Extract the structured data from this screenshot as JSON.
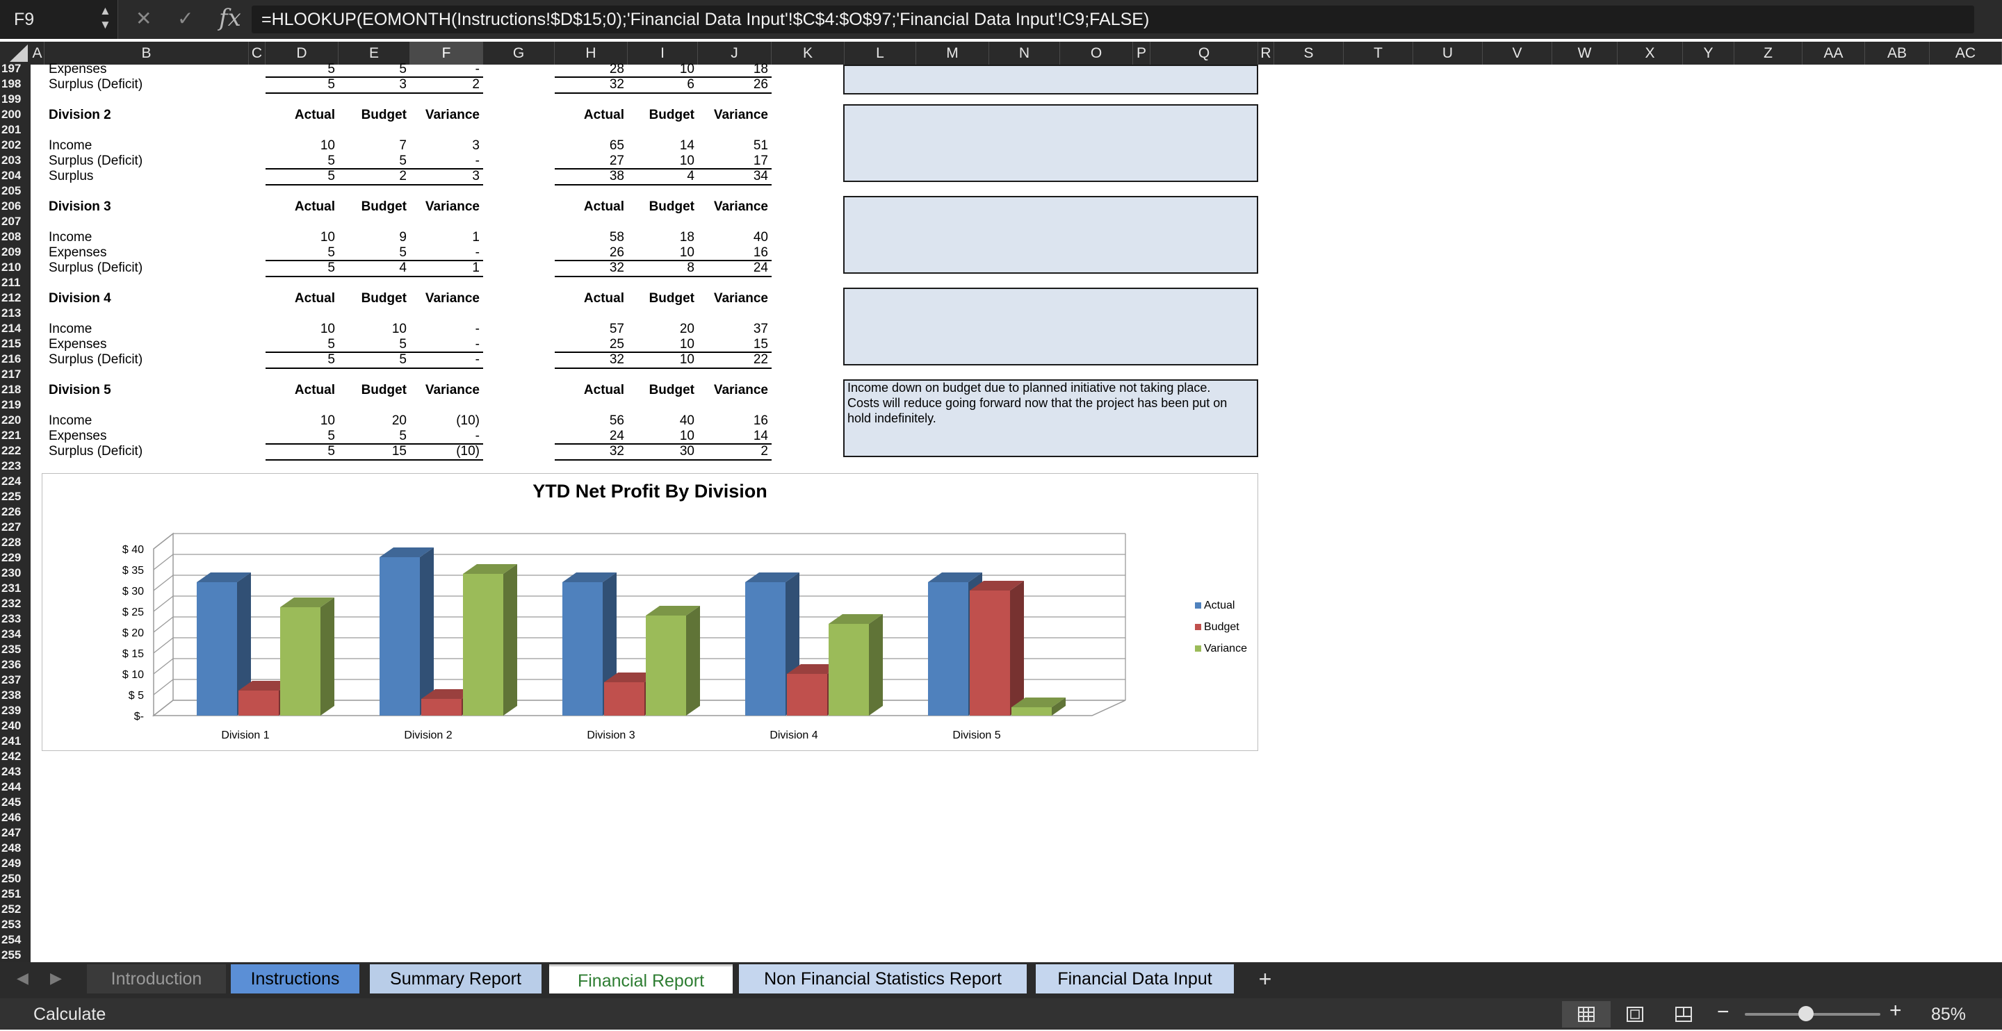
{
  "formula_bar": {
    "name_box": "F9",
    "formula": "=HLOOKUP(EOMONTH(Instructions!$D$15;0);'Financial Data Input'!$C$4:$O$97;'Financial Data Input'!C9;FALSE)"
  },
  "columns": [
    "A",
    "B",
    "C",
    "D",
    "E",
    "F",
    "G",
    "H",
    "I",
    "J",
    "K",
    "L",
    "M",
    "N",
    "O",
    "P",
    "Q",
    "R",
    "S",
    "T",
    "U",
    "V",
    "W",
    "X",
    "Y",
    "Z",
    "AA",
    "AB",
    "AC"
  ],
  "selected_column": "F",
  "rows_start": 197,
  "rows_end": 255,
  "sheet": {
    "top_rows": [
      {
        "label": "Expenses",
        "d": "5",
        "e": "5",
        "f": "-",
        "h": "28",
        "i": "10",
        "j": "18"
      },
      {
        "label": "Surplus (Deficit)",
        "d": "5",
        "e": "3",
        "f": "2",
        "h": "32",
        "i": "6",
        "j": "26"
      }
    ],
    "header_labels": {
      "actual": "Actual",
      "budget": "Budget",
      "variance": "Variance"
    },
    "divisions": [
      {
        "title": "Division 2",
        "rows": [
          {
            "label": "Income",
            "d": "10",
            "e": "7",
            "f": "3",
            "h": "65",
            "i": "14",
            "j": "51"
          },
          {
            "label": "Surplus (Deficit)",
            "d": "5",
            "e": "5",
            "f": "-",
            "h": "27",
            "i": "10",
            "j": "17"
          },
          {
            "label": "Surplus",
            "d": "5",
            "e": "2",
            "f": "3",
            "h": "38",
            "i": "4",
            "j": "34"
          }
        ],
        "note": ""
      },
      {
        "title": "Division 3",
        "rows": [
          {
            "label": "Income",
            "d": "10",
            "e": "9",
            "f": "1",
            "h": "58",
            "i": "18",
            "j": "40"
          },
          {
            "label": "Expenses",
            "d": "5",
            "e": "5",
            "f": "-",
            "h": "26",
            "i": "10",
            "j": "16"
          },
          {
            "label": "Surplus (Deficit)",
            "d": "5",
            "e": "4",
            "f": "1",
            "h": "32",
            "i": "8",
            "j": "24"
          }
        ],
        "note": ""
      },
      {
        "title": "Division 4",
        "rows": [
          {
            "label": "Income",
            "d": "10",
            "e": "10",
            "f": "-",
            "h": "57",
            "i": "20",
            "j": "37"
          },
          {
            "label": "Expenses",
            "d": "5",
            "e": "5",
            "f": "-",
            "h": "25",
            "i": "10",
            "j": "15"
          },
          {
            "label": "Surplus (Deficit)",
            "d": "5",
            "e": "5",
            "f": "-",
            "h": "32",
            "i": "10",
            "j": "22"
          }
        ],
        "note": ""
      },
      {
        "title": "Division 5",
        "rows": [
          {
            "label": "Income",
            "d": "10",
            "e": "20",
            "f": "(10)",
            "h": "56",
            "i": "40",
            "j": "16"
          },
          {
            "label": "Expenses",
            "d": "5",
            "e": "5",
            "f": "-",
            "h": "24",
            "i": "10",
            "j": "14"
          },
          {
            "label": "Surplus (Deficit)",
            "d": "5",
            "e": "15",
            "f": "(10)",
            "h": "32",
            "i": "30",
            "j": "2"
          }
        ],
        "note_lines": [
          "Income down on budget due to planned initiative not taking place.",
          "Costs will reduce going forward now that the project has been put on",
          "hold indefinitely."
        ]
      }
    ]
  },
  "chart_data": {
    "type": "bar",
    "title": "YTD Net Profit By Division",
    "categories": [
      "Division 1",
      "Division 2",
      "Division 3",
      "Division 4",
      "Division 5"
    ],
    "series": [
      {
        "name": "Actual",
        "color": "#4f81bd",
        "values": [
          32,
          38,
          32,
          32,
          32
        ]
      },
      {
        "name": "Budget",
        "color": "#c0504d",
        "values": [
          6,
          4,
          8,
          10,
          30
        ]
      },
      {
        "name": "Variance",
        "color": "#9bbb59",
        "values": [
          26,
          34,
          24,
          22,
          2
        ]
      }
    ],
    "y_ticks": [
      "$-",
      "$ 5",
      "$ 10",
      "$ 15",
      "$ 20",
      "$ 25",
      "$ 30",
      "$ 35",
      "$ 40"
    ],
    "ylim": [
      0,
      40
    ],
    "legend_position": "right",
    "grid": true
  },
  "tabs": {
    "introduction": "Introduction",
    "instructions": "Instructions",
    "summary": "Summary Report",
    "financial": "Financial Report",
    "non_financial": "Non Financial Statistics Report",
    "data_input": "Financial Data Input",
    "add": "+"
  },
  "status": {
    "text": "Calculate",
    "zoom": "85%",
    "zoom_fraction": 0.45
  },
  "icons": {
    "cancel": "close-icon",
    "enter": "check-icon",
    "fx": "function-icon"
  }
}
